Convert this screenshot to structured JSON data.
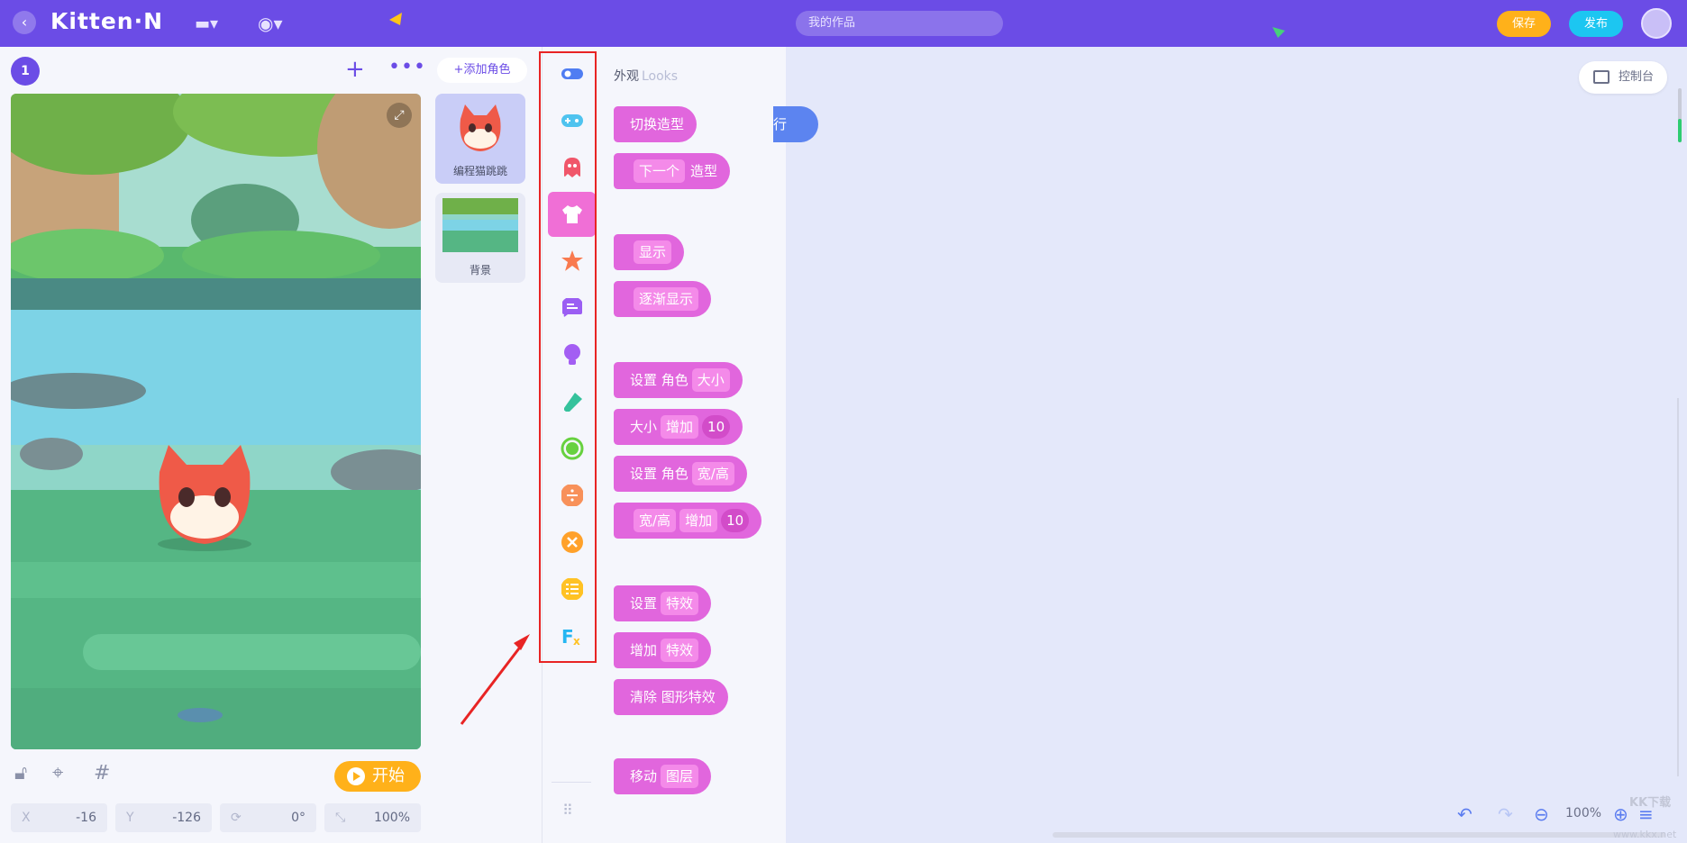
{
  "topbar": {
    "logo": "Kitten·N",
    "search_placeholder": "我的作品",
    "save": "保存",
    "publish": "发布"
  },
  "stage_panel": {
    "scene_number": "1",
    "start_button": "开始",
    "coords": {
      "x_label": "X",
      "x_value": "-16",
      "y_label": "Y",
      "y_value": "-126",
      "rotation_value": "0°",
      "scale_value": "100%"
    }
  },
  "sprites": {
    "add_button": "+添加角色",
    "items": [
      {
        "name": "编程猫跳跳"
      },
      {
        "name": "背景"
      }
    ]
  },
  "categories": {
    "items": [
      {
        "name": "event-icon",
        "color": "#4f7df2"
      },
      {
        "name": "gamepad-icon",
        "color": "#4fc3ef"
      },
      {
        "name": "ghost-icon",
        "color": "#f0566a"
      },
      {
        "name": "shirt-icon",
        "color": "#ffffff",
        "active": true
      },
      {
        "name": "star-splash-icon",
        "color": "#f97a4f"
      },
      {
        "name": "speech-icon",
        "color": "#9b5ef3"
      },
      {
        "name": "bulb-icon",
        "color": "#a35ef3"
      },
      {
        "name": "pen-icon",
        "color": "#35c29c"
      },
      {
        "name": "circle-icon",
        "color": "#67d13f"
      },
      {
        "name": "math-icon",
        "color": "#f8915a"
      },
      {
        "name": "close-circle-icon",
        "color": "#ffa12a"
      },
      {
        "name": "list-icon",
        "color": "#ffc224"
      },
      {
        "name": "function-icon",
        "color": "#25b6f2"
      }
    ]
  },
  "palette": {
    "title": "外观",
    "title_en": "Looks",
    "blocks": [
      {
        "parts": [
          {
            "t": "切换造型"
          }
        ]
      },
      {
        "parts": [
          {
            "t": "下一个",
            "pill": true
          },
          {
            "t": "造型"
          }
        ]
      },
      {
        "parts": [
          {
            "t": "显示",
            "pill": true
          }
        ]
      },
      {
        "parts": [
          {
            "t": "逐渐显示",
            "pill": true
          }
        ]
      },
      {
        "parts": [
          {
            "t": "设置 角色"
          },
          {
            "t": "大小",
            "pill": true
          }
        ]
      },
      {
        "parts": [
          {
            "t": "大小"
          },
          {
            "t": "增加",
            "pill": true
          },
          {
            "t": "10",
            "round": true
          }
        ]
      },
      {
        "parts": [
          {
            "t": "设置 角色"
          },
          {
            "t": "宽/高",
            "pill": true
          }
        ]
      },
      {
        "parts": [
          {
            "t": "宽/高",
            "pill": true
          },
          {
            "t": "增加",
            "pill": true
          },
          {
            "t": "10",
            "round": true
          }
        ]
      },
      {
        "parts": [
          {
            "t": "设置"
          },
          {
            "t": "特效",
            "pill": true
          }
        ]
      },
      {
        "parts": [
          {
            "t": "增加"
          },
          {
            "t": "特效",
            "pill": true
          }
        ]
      },
      {
        "parts": [
          {
            "t": "清除 图形特效"
          }
        ]
      },
      {
        "parts": [
          {
            "t": "移动"
          },
          {
            "t": "图层",
            "pill": true
          }
        ]
      }
    ]
  },
  "workspace": {
    "peek_block_text": "行",
    "console_button": "控制台",
    "zoom_value": "100%",
    "watermark": "KK下载",
    "watermark_url": "www.kkx.net"
  },
  "colors": {
    "brand": "#6b4ce6",
    "looks_block": "#e166dd",
    "save": "#ffb11a",
    "publish": "#1cc6f1",
    "highlight_box": "#e82424"
  }
}
